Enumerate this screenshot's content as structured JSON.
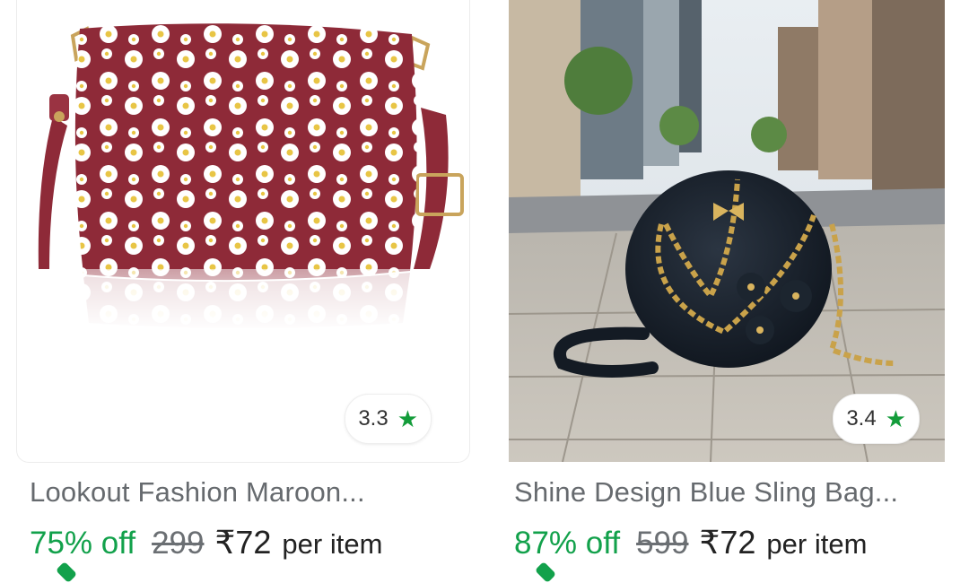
{
  "products": [
    {
      "title": "Lookout Fashion Maroon...",
      "rating": "3.3",
      "rating_icon": "star-icon",
      "discount": "75% off",
      "mrp": "299",
      "price": "₹72",
      "unit": "per item",
      "image_desc": "maroon daisy print sling bag"
    },
    {
      "title": "Shine Design Blue Sling Bag...",
      "rating": "3.4",
      "rating_icon": "star-icon",
      "discount": "87% off",
      "mrp": "599",
      "price": "₹72",
      "unit": "per item",
      "image_desc": "black round chain sling bag on city street"
    }
  ],
  "colors": {
    "discount": "#12a14b",
    "star": "#139c3a",
    "maroon_bag": "#8e2a38",
    "title_text": "#666a6e"
  }
}
